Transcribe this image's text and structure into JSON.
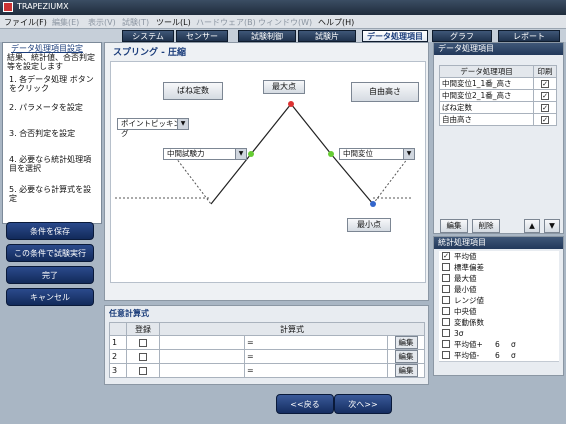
{
  "app": {
    "title": "TRAPEZIUMX"
  },
  "menu": {
    "items": [
      {
        "label": "ファイル(F)",
        "enabled": true
      },
      {
        "label": "編集(E)",
        "enabled": false
      },
      {
        "label": "表示(V)",
        "enabled": false
      },
      {
        "label": "試験(T)",
        "enabled": false
      },
      {
        "label": "ツール(L)",
        "enabled": true
      },
      {
        "label": "ハードウェア(B)",
        "enabled": false
      },
      {
        "label": "ウィンドウ(W)",
        "enabled": false
      },
      {
        "label": "ヘルプ(H)",
        "enabled": true
      }
    ]
  },
  "tabs": [
    "システム",
    "センサー",
    "試験制御",
    "試験片",
    "データ処理項目",
    "グラフ",
    "レポート"
  ],
  "active_tab": "データ処理項目",
  "guide": {
    "title": "データ処理項目設定",
    "subtitle": "結果、統計値、合否判定等を設定します",
    "steps": [
      "1. 各データ処理 ボタンをクリック",
      "2. パラメータを設定",
      "3. 合否判定を設定",
      "4. 必要なら統計処理項目を選択",
      "5. 必要なら計算式を設定"
    ]
  },
  "left_buttons": [
    "条件を保存",
    "この条件で試験実行",
    "完了",
    "キャンセル"
  ],
  "canvas": {
    "title": "スプリング - 圧縮",
    "buttons": {
      "spring_const": "ばね定数",
      "max_point": "最大点",
      "free_height": "自由高さ",
      "min_point": "最小点"
    },
    "dropdowns": {
      "point_picking": "ポイントピッキング",
      "mid_load": "中間試験力",
      "mid_disp": "中間変位"
    }
  },
  "formula": {
    "title": "任意計算式",
    "headers": [
      "登録",
      "計算式"
    ],
    "rows": [
      {
        "num": "1",
        "eq": "=",
        "edit": "編集"
      },
      {
        "num": "2",
        "eq": "=",
        "edit": "編集"
      },
      {
        "num": "3",
        "eq": "=",
        "edit": "編集"
      }
    ]
  },
  "nav": {
    "back": "<<戻る",
    "next": "次へ>>"
  },
  "data_items": {
    "title": "データ処理項目",
    "headers": [
      "データ処理項目",
      "印刷"
    ],
    "rows": [
      {
        "name": "中間変位1_1番_高さ",
        "print": true
      },
      {
        "name": "中間変位2_1番_高さ",
        "print": true
      },
      {
        "name": "ばね定数",
        "print": true
      },
      {
        "name": "自由高さ",
        "print": true
      }
    ],
    "buttons": {
      "edit": "編集",
      "delete": "削除",
      "up": "▲",
      "down": "▼"
    }
  },
  "stats": {
    "title": "統計処理項目",
    "items": [
      {
        "label": "平均値",
        "checked": true
      },
      {
        "label": "標準偏差",
        "checked": false
      },
      {
        "label": "最大値",
        "checked": false
      },
      {
        "label": "最小値",
        "checked": false
      },
      {
        "label": "レンジ値",
        "checked": false
      },
      {
        "label": "中央値",
        "checked": false
      },
      {
        "label": "変動係数",
        "checked": false
      },
      {
        "label": "3σ",
        "checked": false
      },
      {
        "label": "平均値+",
        "checked": false,
        "n": "6",
        "unit": "σ"
      },
      {
        "label": "平均値-",
        "checked": false,
        "n": "6",
        "unit": "σ"
      }
    ]
  }
}
